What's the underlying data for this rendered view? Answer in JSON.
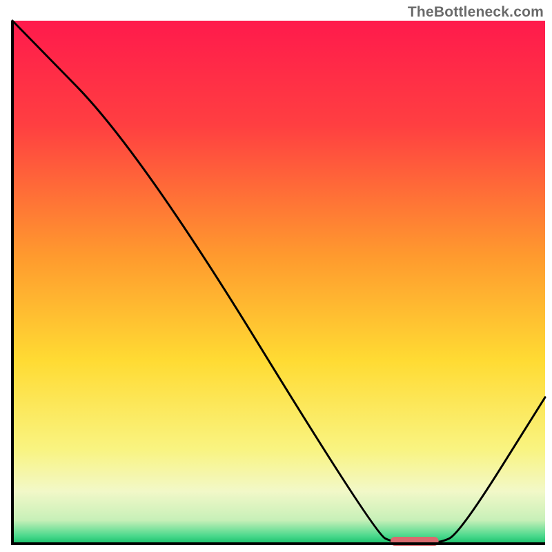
{
  "watermark": "TheBottleneck.com",
  "chart_data": {
    "type": "line",
    "title": "",
    "xlabel": "",
    "ylabel": "",
    "xlim": [
      0,
      100
    ],
    "ylim": [
      0,
      100
    ],
    "grid": false,
    "legend": false,
    "curve_points": [
      {
        "x": 0,
        "y": 100
      },
      {
        "x": 24,
        "y": 75
      },
      {
        "x": 68,
        "y": 2
      },
      {
        "x": 72,
        "y": 0
      },
      {
        "x": 80,
        "y": 0
      },
      {
        "x": 84,
        "y": 2
      },
      {
        "x": 100,
        "y": 28
      }
    ],
    "optimal_marker": {
      "x_start": 71,
      "x_end": 80,
      "y": 0,
      "color": "#d96a6f"
    },
    "gradient_stops": [
      {
        "offset": 0,
        "color": "#ff1a4c"
      },
      {
        "offset": 0.2,
        "color": "#ff3f41"
      },
      {
        "offset": 0.45,
        "color": "#ff9a2e"
      },
      {
        "offset": 0.65,
        "color": "#ffdb33"
      },
      {
        "offset": 0.82,
        "color": "#f9f481"
      },
      {
        "offset": 0.9,
        "color": "#f2f8c8"
      },
      {
        "offset": 0.955,
        "color": "#c7f0b8"
      },
      {
        "offset": 0.985,
        "color": "#4bd98c"
      },
      {
        "offset": 1.0,
        "color": "#18c06b"
      }
    ],
    "axis_color": "#000000"
  }
}
